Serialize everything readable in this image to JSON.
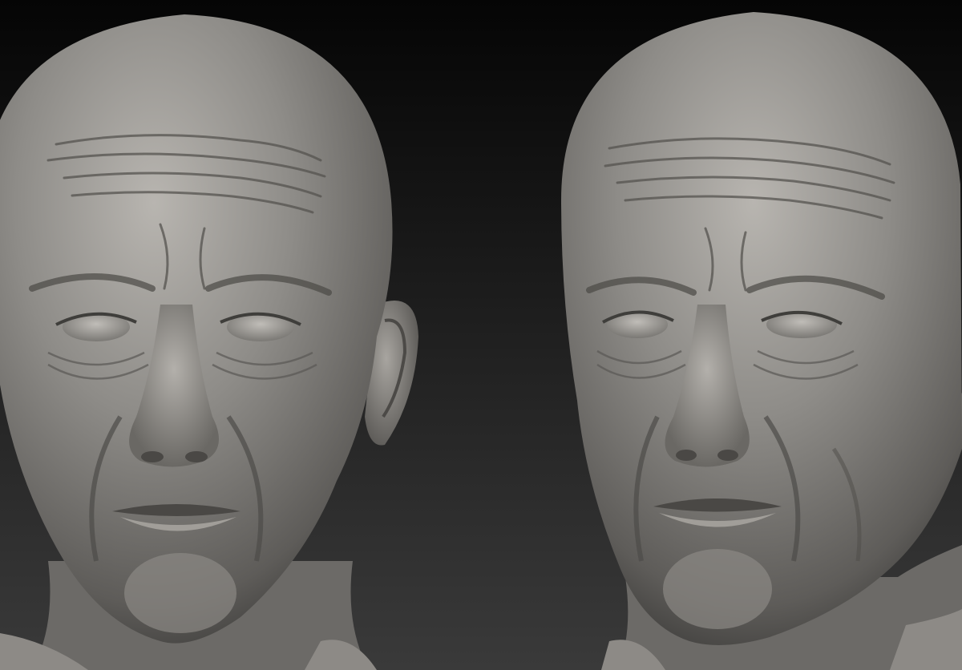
{
  "viewport": {
    "background_top": "#050505",
    "background_bottom": "#3a3a3a",
    "material_color": "#8a8885",
    "shadow_color": "#3b3a38",
    "highlight_color": "#c9c6c1"
  },
  "models": [
    {
      "view": "front",
      "icon": "sculpted-head"
    },
    {
      "view": "three-quarter",
      "icon": "sculpted-head"
    }
  ]
}
